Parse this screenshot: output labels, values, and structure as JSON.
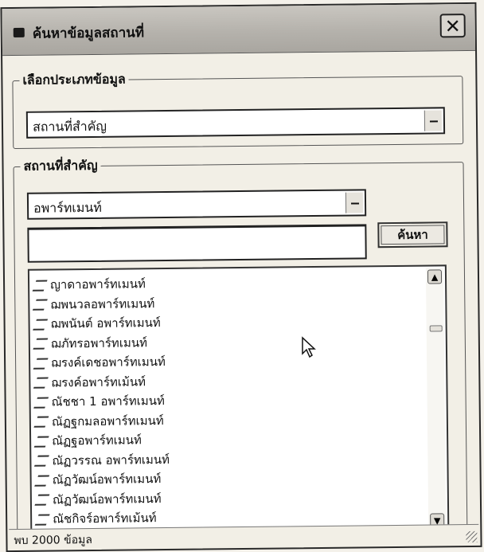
{
  "window": {
    "title": "ค้นหาข้อมูลสถานที่",
    "close_label": "✕"
  },
  "category_group": {
    "legend": "เลือกประเภทข้อมูล",
    "selected": "สถานที่สำคัญ"
  },
  "place_group": {
    "legend": "สถานที่สำคัญ",
    "selected": "อพาร์ทเมนท์",
    "search_value": "",
    "search_button": "ค้นหา",
    "results": [
      "ญาดาอพาร์ทเมนท์",
      "ฌพนวลอพาร์ทเมนท์",
      "ฌพนันต์ อพาร์ทเมนท์",
      "ฌภัทรอพาร์ทเมนท์",
      "ฌรงค์เดชอพาร์ทเมนท์",
      "ฌรงค์อพาร์ทเม้นท์",
      "ณัชชา 1 อพาร์ทเมนท์",
      "ณัฏฐกมลอพาร์ทเมนท์",
      "ณัฏฐอพาร์ทเมนท์",
      "ณัฏวรรณ อพาร์ทเมนท์",
      "ณัฏวัฒน์อพาร์ทเมนท์",
      "ณัฏวัฒน์อพาร์ทเมนท์",
      "ณัชกิจร์อพาร์ทเม้นท์"
    ]
  },
  "status": {
    "text": "พบ 2000 ข้อมูล"
  }
}
